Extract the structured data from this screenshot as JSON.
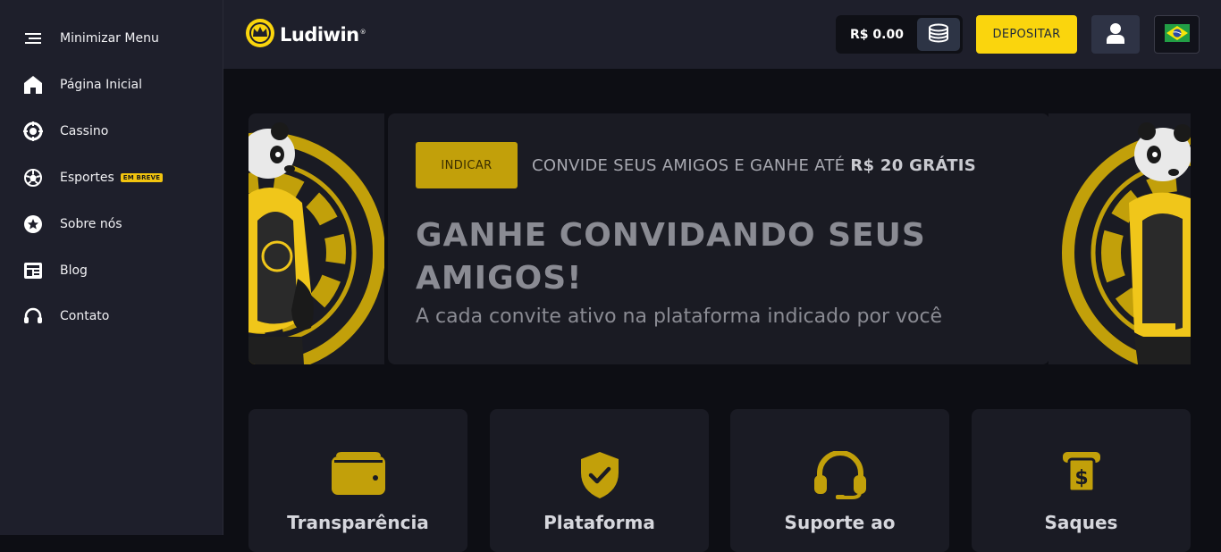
{
  "sidebar": {
    "items": [
      {
        "label": "Minimizar Menu",
        "icon": "menu-icon"
      },
      {
        "label": "Página Inicial",
        "icon": "home-icon"
      },
      {
        "label": "Cassino",
        "icon": "casino-chip-icon"
      },
      {
        "label": "Esportes",
        "icon": "sports-ball-icon",
        "badge": "EM BREVE"
      },
      {
        "label": "Sobre nós",
        "icon": "star-badge-icon"
      },
      {
        "label": "Blog",
        "icon": "newspaper-icon"
      },
      {
        "label": "Contato",
        "icon": "headset-icon"
      }
    ]
  },
  "header": {
    "logo_text": "Ludiwin",
    "logo_mark": "®",
    "balance": "R$ 0.00",
    "deposit_label": "DEPOSITAR"
  },
  "banner": {
    "button_label": "INDICAR",
    "invite_text": "CONVIDE SEUS AMIGOS E GANHE ATÉ ",
    "invite_bold": "R$ 20 GRÁTIS",
    "headline": "GANHE CONVIDANDO SEUS AMIGOS!",
    "subline": "A cada convite ativo na plataforma indicado por você"
  },
  "features": [
    {
      "title": "Transparência",
      "icon": "wallet-icon"
    },
    {
      "title": "Plataforma",
      "icon": "shield-check-icon"
    },
    {
      "title": "Suporte ao",
      "icon": "headset-icon"
    },
    {
      "title": "Saques",
      "icon": "cash-withdraw-icon"
    }
  ],
  "colors": {
    "accent": "#fad50d",
    "gold": "#c2a00a",
    "sidebar_bg": "#1e1f2b",
    "page_bg": "#0d0e14"
  }
}
